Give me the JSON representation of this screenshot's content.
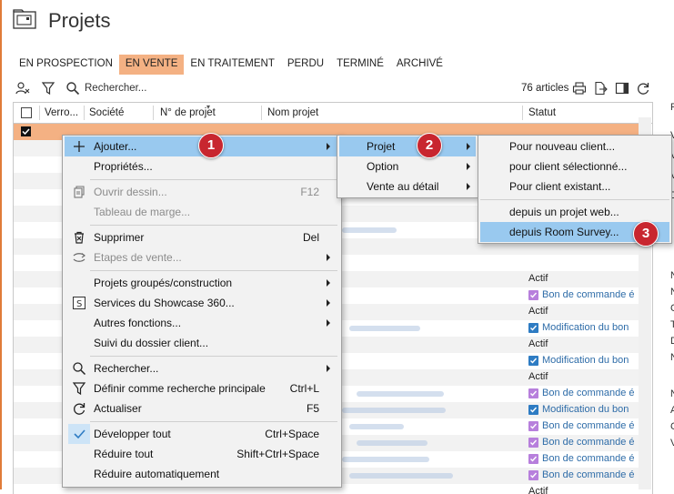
{
  "title": "Projets",
  "tabs": [
    {
      "label": "EN PROSPECTION",
      "active": false
    },
    {
      "label": "EN VENTE",
      "active": true
    },
    {
      "label": "EN TRAITEMENT",
      "active": false
    },
    {
      "label": "PERDU",
      "active": false
    },
    {
      "label": "TERMINÉ",
      "active": false
    },
    {
      "label": "ARCHIVÉ",
      "active": false
    }
  ],
  "search": {
    "placeholder": "Rechercher..."
  },
  "count": "76 articles",
  "columns": {
    "verrou": "Verro...",
    "societe": "Société",
    "numero": "N° de projet",
    "nom": "Nom projet",
    "statut": "Statut"
  },
  "status_rows": [
    {
      "text": "Actif",
      "checkbox": "none"
    },
    {
      "text": "Bon de commande é",
      "checkbox": "purple"
    },
    {
      "text": "Actif",
      "checkbox": "none"
    },
    {
      "text": "Modification du bon",
      "checkbox": "blue"
    },
    {
      "text": "Actif",
      "checkbox": "none"
    },
    {
      "text": "Modification du bon",
      "checkbox": "blue"
    },
    {
      "text": "Actif",
      "checkbox": "none"
    },
    {
      "text": "Bon de commande é",
      "checkbox": "purple"
    },
    {
      "text": "Modification du bon",
      "checkbox": "blue"
    },
    {
      "text": "Bon de commande é",
      "checkbox": "purple"
    },
    {
      "text": "Bon de commande é",
      "checkbox": "purple"
    },
    {
      "text": "Bon de commande é",
      "checkbox": "purple"
    },
    {
      "text": "Bon de commande é",
      "checkbox": "purple"
    },
    {
      "text": "Actif",
      "checkbox": "none"
    }
  ],
  "right_panel_letters": [
    "F",
    "V",
    "V",
    "V",
    "D",
    "N",
    "N",
    "C",
    "T",
    "D",
    "N",
    "N",
    "A",
    "C",
    "V"
  ],
  "context_menu": {
    "ajouter": "Ajouter...",
    "proprietes": "Propriétés...",
    "ouvrir_dessin": "Ouvrir dessin...",
    "ouvrir_dessin_shortcut": "F12",
    "tableau_marge": "Tableau de marge...",
    "supprimer": "Supprimer",
    "supprimer_shortcut": "Del",
    "etapes_vente": "Etapes de vente...",
    "projets_groupes": "Projets groupés/construction",
    "services_showcase": "Services du Showcase 360...",
    "autres_fonctions": "Autres fonctions...",
    "suivi_dossier": "Suivi du dossier client...",
    "rechercher": "Rechercher...",
    "definir_recherche": "Définir comme recherche principale",
    "definir_recherche_shortcut": "Ctrl+L",
    "actualiser": "Actualiser",
    "actualiser_shortcut": "F5",
    "developper_tout": "Développer tout",
    "developper_tout_shortcut": "Ctrl+Space",
    "reduire_tout": "Réduire tout",
    "reduire_tout_shortcut": "Shift+Ctrl+Space",
    "reduire_auto": "Réduire automatiquement"
  },
  "submenu1": {
    "projet": "Projet",
    "option": "Option",
    "vente_detail": "Vente au détail"
  },
  "submenu2": {
    "nouveau_client": "Pour nouveau client...",
    "client_selectionne": "pour client sélectionné...",
    "client_existant": "Pour client existant...",
    "projet_web": "depuis un projet web...",
    "room_survey": "depuis Room Survey..."
  },
  "badges": {
    "b1": "1",
    "b2": "2",
    "b3": "3"
  },
  "colors": {
    "accent": "#e07b39",
    "tab_active": "#f4b183",
    "highlight": "#99c9ef",
    "badge": "#c8262f",
    "check_blue": "#2e7cc3",
    "check_purple": "#b77fdc"
  }
}
